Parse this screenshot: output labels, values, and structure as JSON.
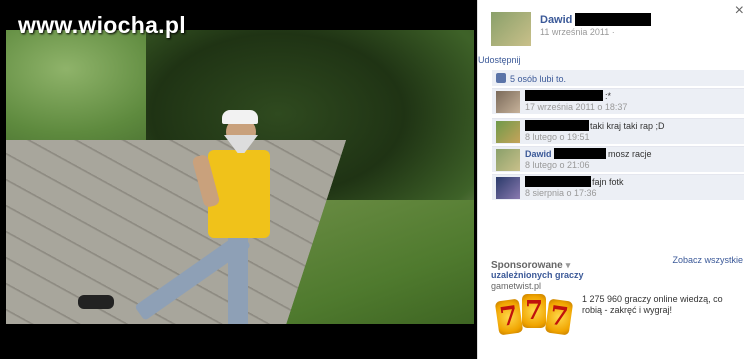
{
  "watermark": "www.wiocha.pl",
  "photo_panel": {
    "close_icon": "close-icon"
  },
  "owner": {
    "name": "Dawid",
    "date": "11 września 2011 ·"
  },
  "share_link": "Udostępnij",
  "likes_text": "5 osób lubi to.",
  "comments": [
    {
      "name": "",
      "text": ":*",
      "date": "17 września 2011 o 18:37"
    },
    {
      "name": "",
      "text": "taki kraj taki rap ;D",
      "date": "8 lutego o 19:51"
    },
    {
      "name": "Dawid",
      "text": "mosz racje",
      "date": "8 lutego o 21:06"
    },
    {
      "name": "",
      "text": "fajn fotk",
      "date": "8 sierpnia o 17:36"
    }
  ],
  "sponsored": {
    "label": "Sponsorowane",
    "see_all": "Zobacz wszystkie"
  },
  "ad": {
    "title": "uzależnionych graczy",
    "domain": "gametwist.pl",
    "slot_symbols": [
      "7",
      "7",
      "7"
    ],
    "description": "1 275 960 graczy online wiedzą, co robią - zakręć i wygraj!"
  },
  "colors": {
    "link": "#3b5998",
    "panel_bg": "#eceff5",
    "redaction": "#000000"
  }
}
